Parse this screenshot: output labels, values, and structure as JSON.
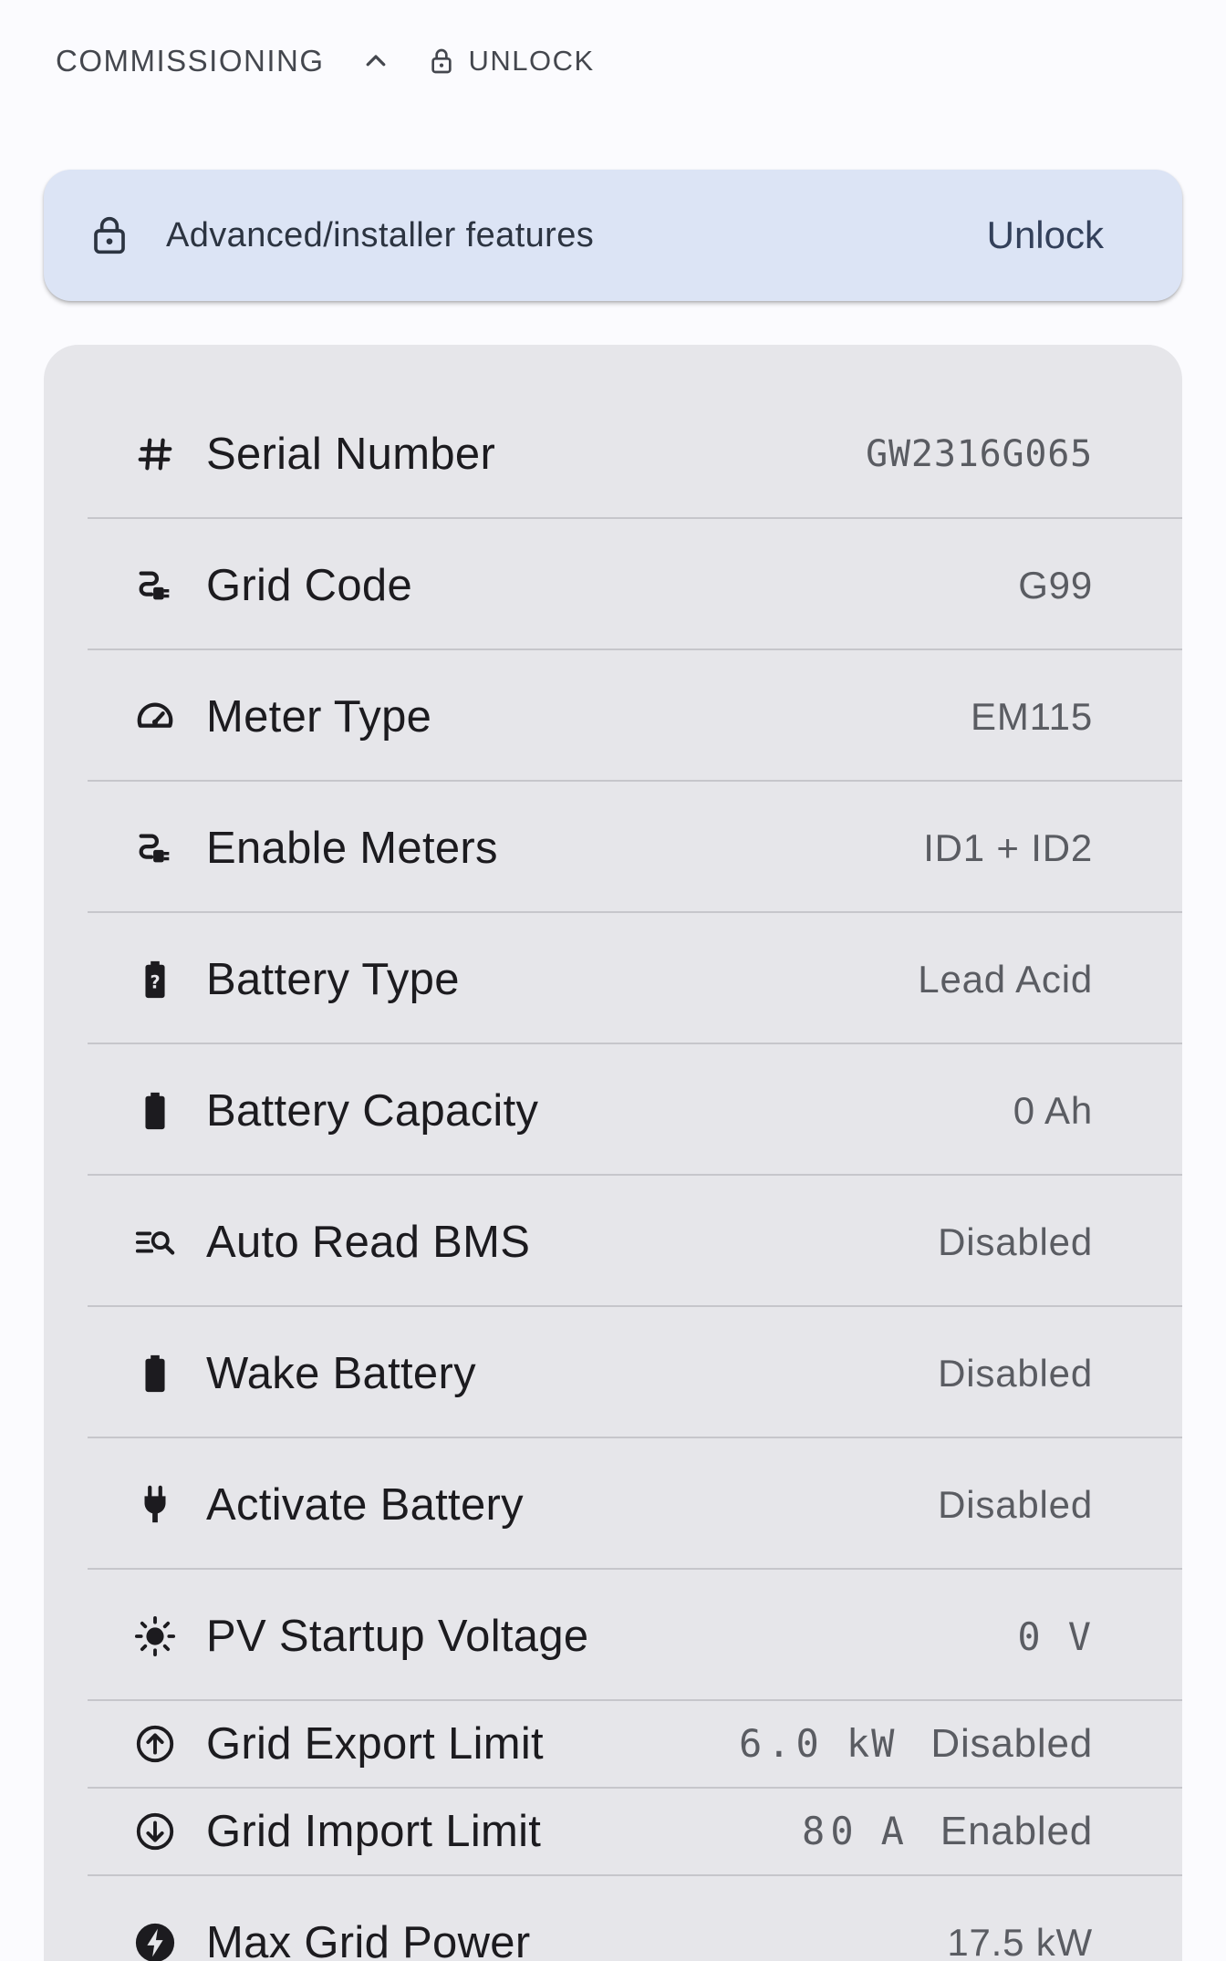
{
  "header": {
    "title": "COMMISSIONING",
    "unlock_label": "UNLOCK"
  },
  "banner": {
    "text": "Advanced/installer features",
    "button": "Unlock"
  },
  "rows": [
    {
      "icon": "hash-icon",
      "label": "Serial Number",
      "value": "GW2316G065"
    },
    {
      "icon": "meter-plug-icon",
      "label": "Grid Code",
      "value": "G99"
    },
    {
      "icon": "gauge-icon",
      "label": "Meter Type",
      "value": "EM115"
    },
    {
      "icon": "meter-plug-icon",
      "label": "Enable Meters",
      "value": "ID1 + ID2"
    },
    {
      "icon": "battery-unknown-icon",
      "label": "Battery Type",
      "value": "Lead Acid"
    },
    {
      "icon": "battery-full-icon",
      "label": "Battery Capacity",
      "value": "0 Ah"
    },
    {
      "icon": "list-search-icon",
      "label": "Auto Read BMS",
      "value": "Disabled"
    },
    {
      "icon": "battery-full-icon",
      "label": "Wake Battery",
      "value": "Disabled"
    },
    {
      "icon": "power-plug-icon",
      "label": "Activate Battery",
      "value": "Disabled"
    },
    {
      "icon": "sun-icon",
      "label": "PV Startup Voltage",
      "num": "0",
      "unit": "V"
    },
    {
      "icon": "arrow-up-circle-icon",
      "label": "Grid Export Limit",
      "num": "6.0",
      "unit": "kW",
      "status": "Disabled"
    },
    {
      "icon": "arrow-down-circle-icon",
      "label": "Grid Import Limit",
      "num": "80",
      "unit": "A",
      "status": "Enabled"
    },
    {
      "icon": "lightning-circle-icon",
      "label": "Max Grid Power",
      "value": "17.5 kW"
    }
  ]
}
